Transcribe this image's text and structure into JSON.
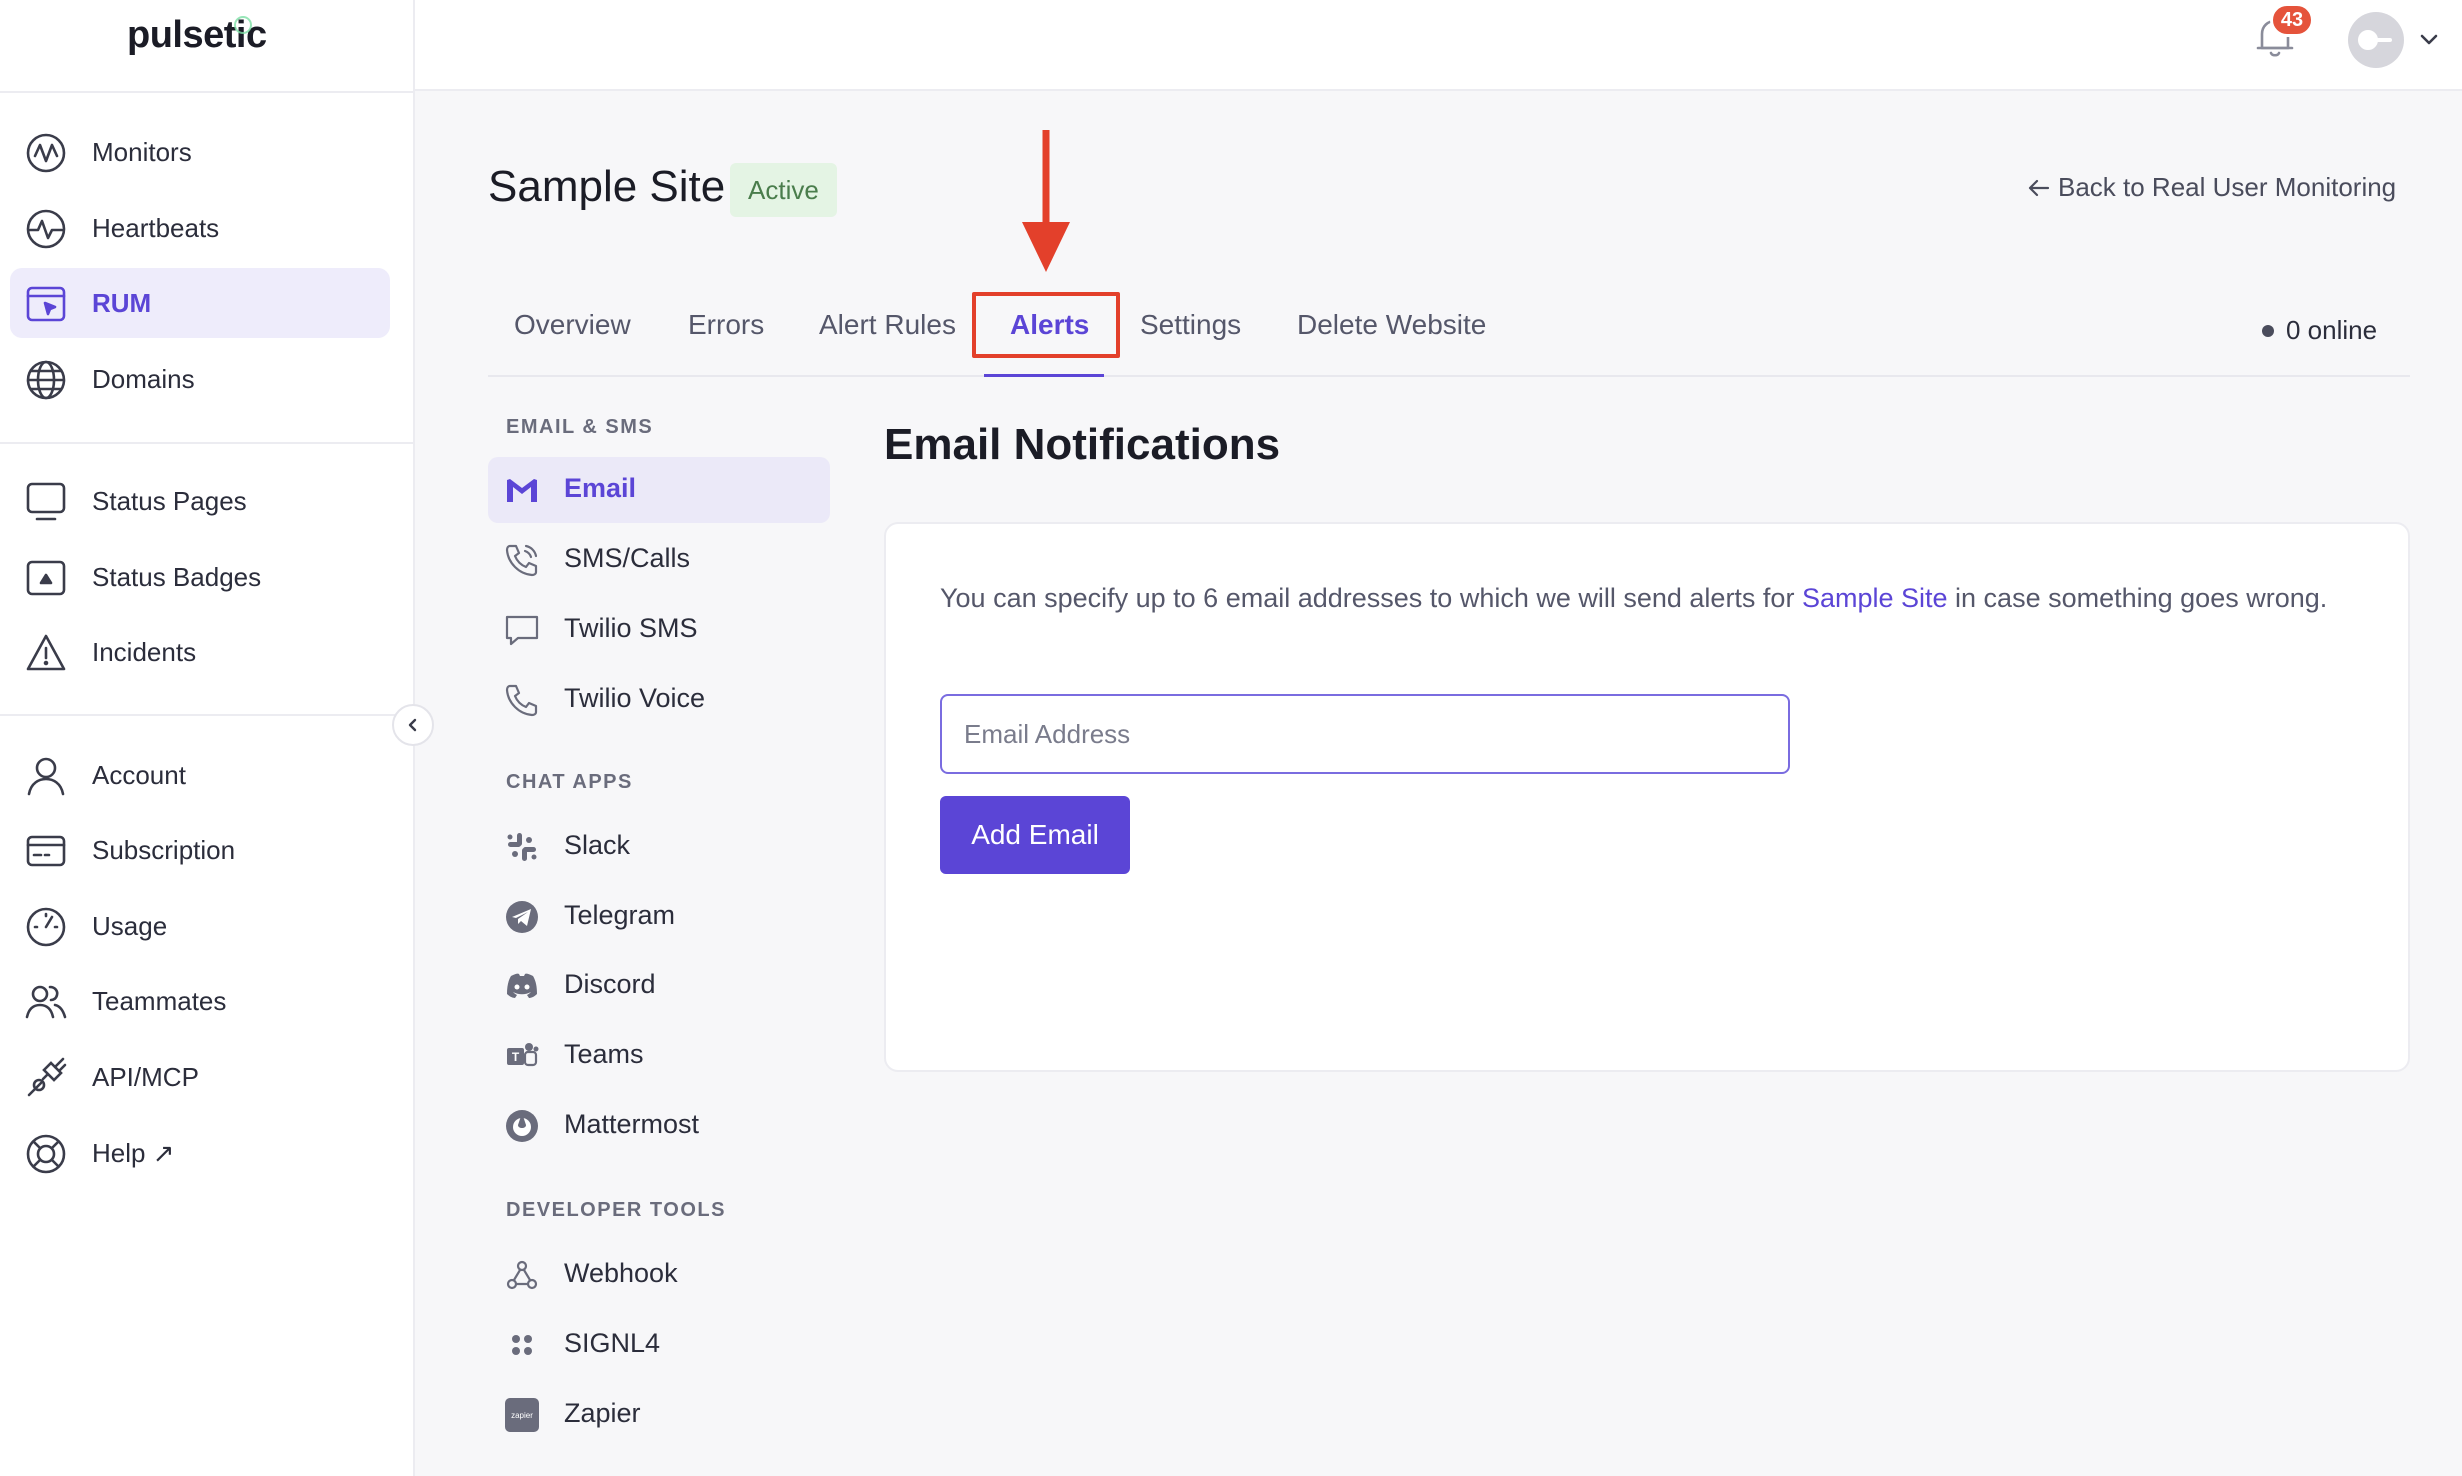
{
  "app": {
    "logo": "pulsetic"
  },
  "sidebar": {
    "groups": [
      [
        {
          "label": "Monitors",
          "icon": "monitors-icon"
        },
        {
          "label": "Heartbeats",
          "icon": "heartbeat-icon"
        },
        {
          "label": "RUM",
          "icon": "rum-icon",
          "active": true
        },
        {
          "label": "Domains",
          "icon": "globe-icon"
        }
      ],
      [
        {
          "label": "Status Pages",
          "icon": "monitor-screen-icon"
        },
        {
          "label": "Status Badges",
          "icon": "badge-icon"
        },
        {
          "label": "Incidents",
          "icon": "warning-icon"
        }
      ],
      [
        {
          "label": "Account",
          "icon": "user-icon"
        },
        {
          "label": "Subscription",
          "icon": "card-icon"
        },
        {
          "label": "Usage",
          "icon": "gauge-icon"
        },
        {
          "label": "Teammates",
          "icon": "users-icon"
        },
        {
          "label": "API/MCP",
          "icon": "plug-icon"
        },
        {
          "label": "Help ↗",
          "icon": "lifebuoy-icon"
        }
      ]
    ]
  },
  "topbar": {
    "notification_count": "43"
  },
  "header": {
    "site_title": "Sample Site",
    "status": "Active",
    "back_link": "Back to Real User Monitoring"
  },
  "tabs": [
    {
      "label": "Overview"
    },
    {
      "label": "Errors"
    },
    {
      "label": "Alert Rules"
    },
    {
      "label": "Alerts",
      "active": true
    },
    {
      "label": "Settings"
    },
    {
      "label": "Delete Website"
    }
  ],
  "online": "0 online",
  "channels": {
    "email_sms": {
      "title": "EMAIL & SMS",
      "items": [
        {
          "label": "Email",
          "icon": "gmail-icon",
          "active": true
        },
        {
          "label": "SMS/Calls",
          "icon": "phone-calls-icon"
        },
        {
          "label": "Twilio SMS",
          "icon": "chat-bubble-icon"
        },
        {
          "label": "Twilio Voice",
          "icon": "phone-icon"
        }
      ]
    },
    "chat_apps": {
      "title": "CHAT APPS",
      "items": [
        {
          "label": "Slack",
          "icon": "slack-icon"
        },
        {
          "label": "Telegram",
          "icon": "telegram-icon"
        },
        {
          "label": "Discord",
          "icon": "discord-icon"
        },
        {
          "label": "Teams",
          "icon": "teams-icon"
        },
        {
          "label": "Mattermost",
          "icon": "mattermost-icon"
        }
      ]
    },
    "developer_tools": {
      "title": "DEVELOPER TOOLS",
      "items": [
        {
          "label": "Webhook",
          "icon": "webhook-icon"
        },
        {
          "label": "SIGNL4",
          "icon": "signl4-icon"
        },
        {
          "label": "Zapier",
          "icon": "zapier-icon",
          "icon_text": "zapier"
        }
      ]
    }
  },
  "email_notifications": {
    "title": "Email Notifications",
    "description_before": "You can specify up to 6 email addresses to which we will send alerts for ",
    "description_highlight": "Sample Site",
    "description_after": " in case something goes wrong.",
    "input_placeholder": "Email Address",
    "input_value": "",
    "add_button": "Add Email"
  },
  "colors": {
    "accent": "#5b45d6",
    "active_badge_bg": "#e4f4e4",
    "active_badge_text": "#4a7d4c",
    "notification_badge": "#e5533b",
    "annotation_red": "#e3402b"
  }
}
